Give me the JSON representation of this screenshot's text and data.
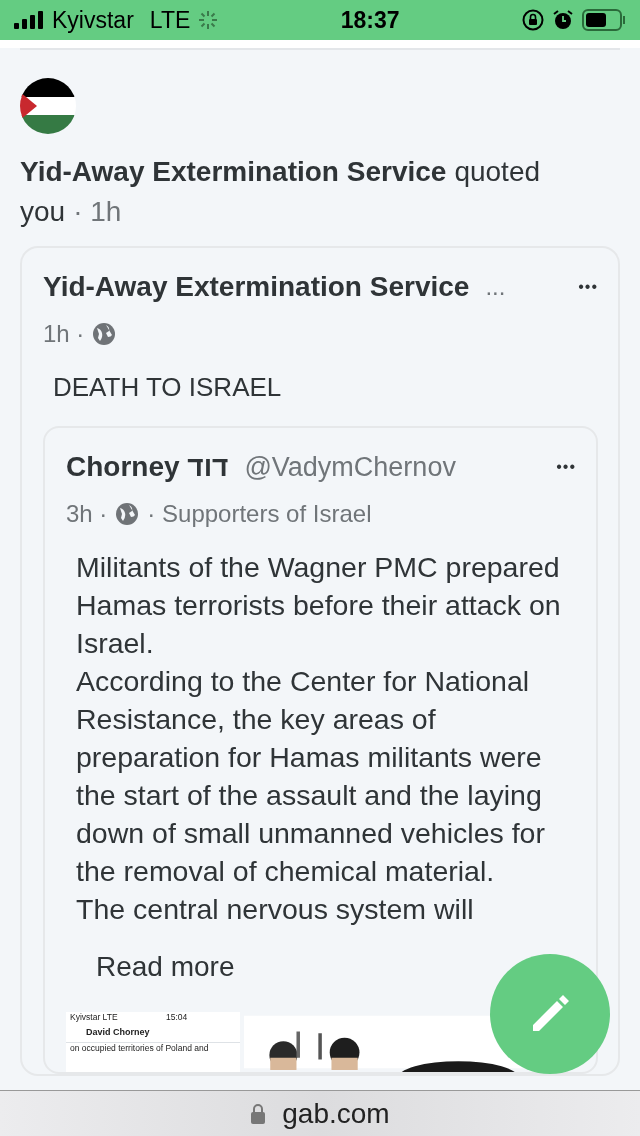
{
  "status_bar": {
    "carrier": "Kyivstar",
    "network": "LTE",
    "time": "18:37"
  },
  "notification": {
    "author": "Yid-Away Extermination Service",
    "action": "quoted",
    "object": "you",
    "time": "· 1h"
  },
  "quote_post": {
    "author": "Yid-Away Extermination Service",
    "ellipsis": "...",
    "menu": "•••",
    "time": "1h ·",
    "text": "DEATH TO ISRAEL",
    "quoted_post": {
      "author": "Chorney דוד",
      "handle": "@VadymChernov",
      "menu": "•••",
      "time": "3h ·",
      "group": "· Supporters of Israel",
      "paragraphs": [
        "Militants of the Wagner PMC prepared Hamas terrorists before their attack on Israel.",
        "According to the Center for National Resistance, the key areas of preparation for Hamas militants were the start of the assault and the laying down of small unmanned vehicles for the removal of chemical material.",
        "The central nervous system will"
      ],
      "read_more": "Read more",
      "media": [
        {
          "kind": "screenshot",
          "carrier": "Kyivstar",
          "network": "LTE",
          "time": "15:04",
          "title": "David Chorney",
          "text": "on occupied territories of Poland and"
        },
        {
          "kind": "picture"
        }
      ]
    }
  },
  "url_bar": {
    "domain": "gab.com"
  }
}
